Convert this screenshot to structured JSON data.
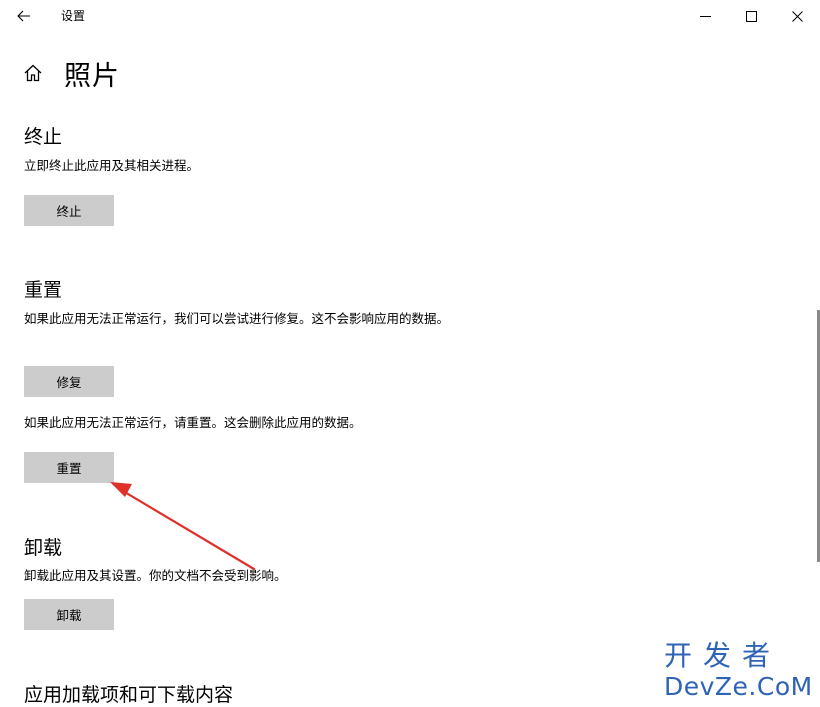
{
  "window": {
    "title": "设置",
    "back_icon": "arrow-left-icon",
    "minimize_icon": "minimize-icon",
    "maximize_icon": "maximize-icon",
    "close_icon": "close-icon"
  },
  "header": {
    "home_icon": "home-icon",
    "title": "照片"
  },
  "sections": {
    "terminate": {
      "title": "终止",
      "description": "立即终止此应用及其相关进程。",
      "button_label": "终止"
    },
    "reset": {
      "title": "重置",
      "repair_description": "如果此应用无法正常运行，我们可以尝试进行修复。这不会影响应用的数据。",
      "repair_button_label": "修复",
      "reset_description": "如果此应用无法正常运行，请重置。这会删除此应用的数据。",
      "reset_button_label": "重置"
    },
    "uninstall": {
      "title": "卸载",
      "description": "卸载此应用及其设置。你的文档不会受到影响。",
      "button_label": "卸载"
    },
    "addons": {
      "title": "应用加载项和可下载内容"
    }
  },
  "annotation": {
    "arrow_color": "#e0302a"
  },
  "watermark": {
    "line1": "开发者",
    "line2": "DevZe.CoM",
    "color": "#2f63b5"
  }
}
